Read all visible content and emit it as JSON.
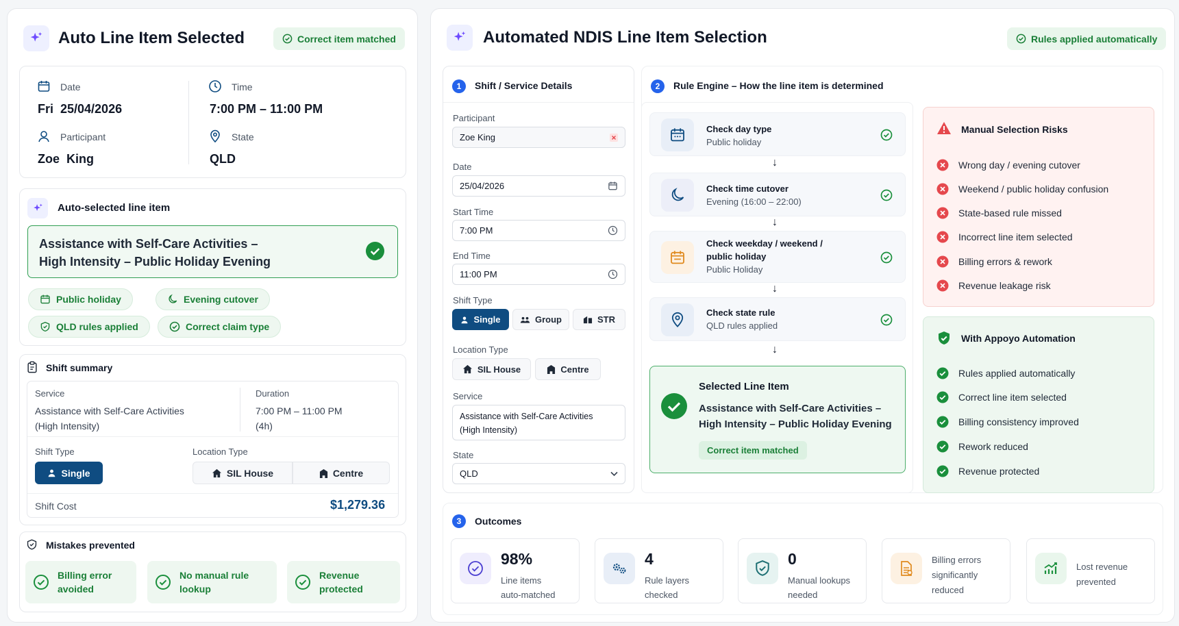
{
  "left": {
    "title": "Auto Line Item Selected",
    "badge": "Correct item matched",
    "date_label": "Date",
    "date_value": "Fri  25/04/2026",
    "time_label": "Time",
    "time_value": "7:00 PM – 11:00 PM",
    "participant_label": "Participant",
    "participant_value": "Zoe  King",
    "state_label": "State",
    "state_value": "QLD",
    "auto_heading": "Auto-selected line item",
    "line_item_1": "Assistance with Self-Care Activities –",
    "line_item_2": "High Intensity – Public Holiday Evening",
    "pills": [
      "Public holiday",
      "Evening cutover",
      "QLD rules applied",
      "Correct claim type"
    ],
    "summary_heading": "Shift summary",
    "service_label": "Service",
    "service_value_1": "Assistance with Self-Care Activities",
    "service_value_2": "(High Intensity)",
    "duration_label": "Duration",
    "duration_value_1": "7:00 PM – 11:00 PM",
    "duration_value_2": "(4h)",
    "shift_type_label": "Shift Type",
    "shift_type_value": "Single",
    "location_type_label": "Location Type",
    "location_options": [
      "SIL House",
      "Centre"
    ],
    "shift_cost_label": "Shift Cost",
    "shift_cost_value": "$1,279.36",
    "mistakes_heading": "Mistakes prevented",
    "mistakes": [
      {
        "l1": "Billing error",
        "l2": "avoided"
      },
      {
        "l1": "No manual rule",
        "l2": "lookup"
      },
      {
        "l1": "Revenue",
        "l2": "protected"
      }
    ]
  },
  "right": {
    "title": "Automated NDIS Line Item Selection",
    "badge": "Rules applied automatically",
    "section1": {
      "num": "1",
      "title": "Shift / Service Details"
    },
    "section2": {
      "num": "2",
      "title": "Rule Engine – How the line item is determined"
    },
    "section3": {
      "num": "3",
      "title": "Outcomes"
    },
    "form": {
      "participant_label": "Participant",
      "participant_value": "Zoe King",
      "date_label": "Date",
      "date_value": "25/04/2026",
      "start_label": "Start Time",
      "start_value": "7:00 PM",
      "end_label": "End Time",
      "end_value": "11:00 PM",
      "shift_type_label": "Shift Type",
      "shift_types": [
        "Single",
        "Group",
        "STR"
      ],
      "location_label": "Location Type",
      "locations": [
        "SIL House",
        "Centre"
      ],
      "service_label": "Service",
      "service_value_1": "Assistance with Self-Care Activities",
      "service_value_2": "(High Intensity)",
      "state_label": "State",
      "state_value": "QLD"
    },
    "steps": [
      {
        "title": "Check day type",
        "sub": "Public holiday"
      },
      {
        "title": "Check time cutover",
        "sub": "Evening (16:00 – 22:00)"
      },
      {
        "title_1": "Check weekday / weekend /",
        "title_2": "public holiday",
        "sub": "Public Holiday"
      },
      {
        "title": "Check state rule",
        "sub": "QLD rules applied"
      }
    ],
    "arrow": "↓",
    "selected": {
      "heading": "Selected Line Item",
      "line_1": "Assistance with Self-Care Activities –",
      "line_2": "High Intensity – Public Holiday Evening",
      "tag": "Correct item matched"
    },
    "risks_heading": "Manual Selection Risks",
    "risks": [
      "Wrong day / evening cutover",
      "Weekend / public holiday confusion",
      "State-based rule missed",
      "Incorrect line item selected",
      "Billing errors & rework",
      "Revenue leakage risk"
    ],
    "benefits_heading": "With Appoyo Automation",
    "benefits": [
      "Rules applied automatically",
      "Correct line item selected",
      "Billing consistency improved",
      "Rework reduced",
      "Revenue protected"
    ],
    "outcomes": [
      {
        "big": "98%",
        "l1": "Line items",
        "l2": "auto-matched"
      },
      {
        "big": "4",
        "l1": "Rule layers",
        "l2": "checked"
      },
      {
        "big": "0",
        "l1": "Manual lookups",
        "l2": "needed"
      },
      {
        "l1": "Billing errors",
        "l2": "significantly",
        "l3": "reduced"
      },
      {
        "l1": "Lost revenue",
        "l2": "prevented"
      }
    ]
  },
  "colors": {
    "accent_green": "#1a7f37",
    "accent_navy": "#0f4c81",
    "risk_red": "#e5484d",
    "sparkle_purple": "#6d4aff"
  }
}
